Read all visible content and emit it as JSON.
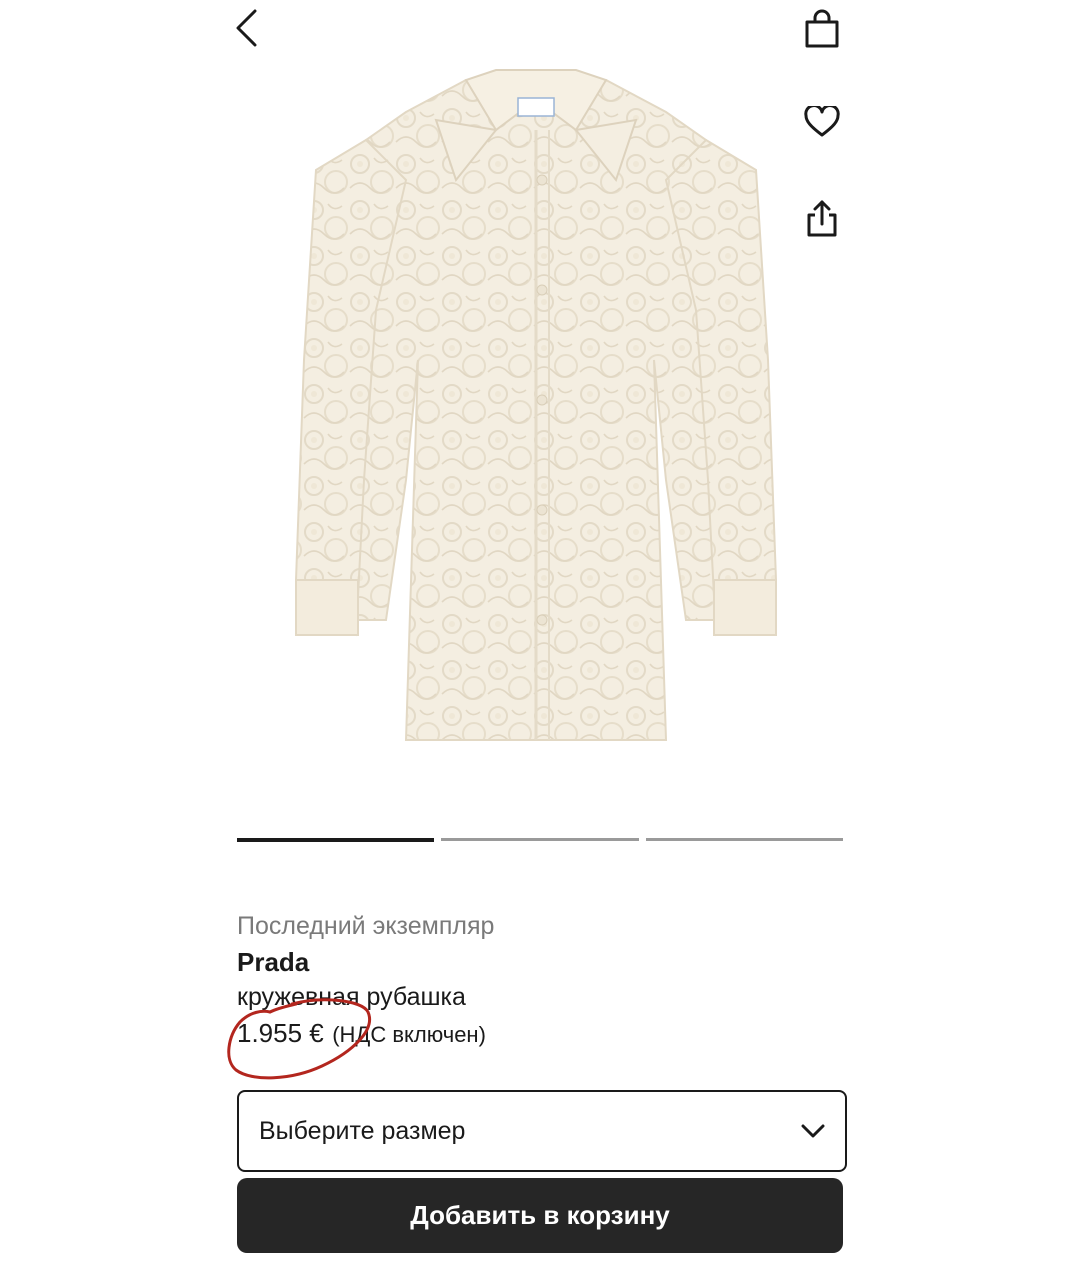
{
  "header": {
    "back_icon": "chevron-left-icon",
    "actions": [
      {
        "icon": "shopping-bag-icon"
      },
      {
        "icon": "heart-icon"
      },
      {
        "icon": "share-icon"
      }
    ]
  },
  "gallery": {
    "image_alt": "lace shirt product photo",
    "total_images": 3,
    "current_index": 1
  },
  "product": {
    "availability": "Последний экземпляр",
    "brand": "Prada",
    "name": "кружевная рубашка",
    "price": "1.955 €",
    "vat_note": "(НДС включен)"
  },
  "size_selector": {
    "placeholder": "Выберите размер",
    "icon": "chevron-down-icon"
  },
  "cta": {
    "add_to_cart_label": "Добавить в корзину"
  },
  "colors": {
    "text": "#1a1a1a",
    "muted": "#7a7a7a",
    "button_bg": "#262626",
    "annotation": "#b3261e",
    "fabric": "#f6f1e6"
  }
}
